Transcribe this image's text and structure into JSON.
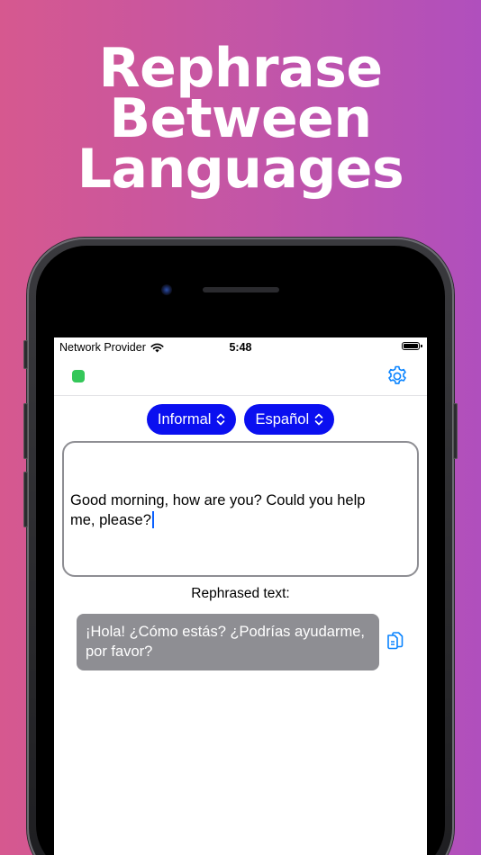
{
  "headline": {
    "line1": "Rephrase",
    "line2": "Between",
    "line3": "Languages"
  },
  "status_bar": {
    "carrier": "Network Provider",
    "time": "5:48"
  },
  "nav": {
    "status_color": "#34c759",
    "settings_icon": "gear-icon"
  },
  "pickers": {
    "tone": "Informal",
    "language": "Español"
  },
  "input": {
    "text": "Good morning, how are you? Could you help me, please?"
  },
  "result": {
    "label": "Rephrased text:",
    "text": "¡Hola! ¿Cómo estás? ¿Podrías ayudarme, por favor?",
    "copy_icon": "copy-icon"
  },
  "colors": {
    "accent": "#0a0ff0",
    "icon_blue": "#0a84ff",
    "bubble_gray": "#8e8e93"
  }
}
